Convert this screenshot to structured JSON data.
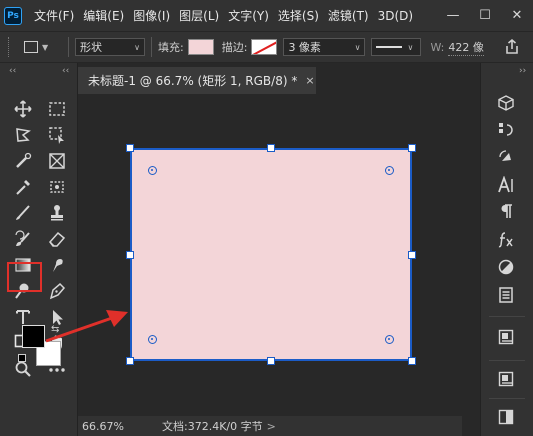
{
  "app": {
    "logo_text": "Ps",
    "brand_color": "#31a8ff"
  },
  "menu": {
    "items": [
      "文件(F)",
      "编辑(E)",
      "图像(I)",
      "图层(L)",
      "文字(Y)",
      "选择(S)",
      "滤镜(T)",
      "3D(D)"
    ]
  },
  "window_controls": {
    "minimize": "—",
    "restore": "☐",
    "close": "✕"
  },
  "options": {
    "mode_value": "形状",
    "fill_label": "填充:",
    "fill_color": "#f3d5d8",
    "stroke_label": "描边:",
    "stroke_width_value": "3 像素",
    "width_label": "W:",
    "width_value": "422 像"
  },
  "document": {
    "tab_title": "未标题-1 @ 66.7% (矩形 1, RGB/8) *",
    "tab_close": "×",
    "canvas_color": "#f3d5d8",
    "path_color": "#1b5cc7"
  },
  "status": {
    "zoom": "66.67%",
    "doc_info": "文档:372.4K/0 字节",
    "arrow": ">"
  },
  "toolbar": {
    "active_tool": "rectangle-tool",
    "highlight_color": "#e0302a",
    "foreground_color": "#000000",
    "background_color": "#ffffff"
  },
  "annotation": {
    "arrow_color": "#e0302a"
  }
}
